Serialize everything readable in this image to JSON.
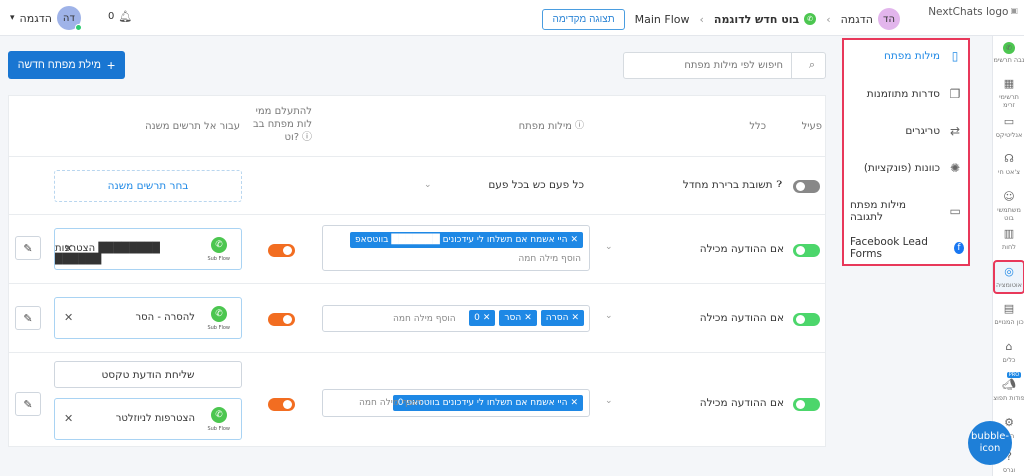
{
  "topbar": {
    "logo_alt": "NextChats logo",
    "workspace_avatar": "הד",
    "workspace_name": "הדגמה",
    "bot_name": "בוט חדש לדוגמה",
    "flow_name": "Main Flow",
    "preview_label": "תצוגה מקדימה",
    "notif_count": "0",
    "user_avatar": "דה",
    "user_name": "הדגמה"
  },
  "rail": {
    "items": [
      {
        "label": "נבה תרשימ",
        "icon": "whatsapp-icon"
      },
      {
        "label": "תרשימי זרימ",
        "icon": "grid-icon"
      },
      {
        "label": "אנליטיקס",
        "icon": "chart-icon"
      },
      {
        "label": "צ'אט חי",
        "icon": "headset-icon"
      },
      {
        "label": "משתמשי בוט",
        "icon": "user-icon"
      },
      {
        "label": "לחות",
        "icon": "book-icon"
      },
      {
        "label": "אוטומציה",
        "icon": "robot-icon"
      },
      {
        "label": "כון המנויים",
        "icon": "calendar-icon"
      },
      {
        "label": "כלים",
        "icon": "store-icon"
      },
      {
        "label": "פודות תפוצ",
        "icon": "megaphone-icon",
        "badge": "PRO"
      },
      {
        "label": "הגד",
        "icon": "gear-icon"
      },
      {
        "label": "וגרס",
        "icon": "help-icon"
      }
    ]
  },
  "submenu": {
    "items": [
      {
        "label": "מילות מפתח",
        "icon": "document-icon",
        "active": true
      },
      {
        "label": "סדרות מתוזמנות",
        "icon": "sequence-icon"
      },
      {
        "label": "טריגרים",
        "icon": "repeat-icon"
      },
      {
        "label": "כוונות (פונקציות)",
        "icon": "openai-icon"
      },
      {
        "label": "מילות מפתח לתגובה",
        "icon": "comment-icon"
      },
      {
        "label": "Facebook Lead Forms",
        "icon": "facebook-icon"
      }
    ]
  },
  "toolbar": {
    "new_keyword": "מילת מפתח חדשה",
    "search_placeholder": "חיפוש לפי מילות מפתח"
  },
  "table": {
    "headers": {
      "active": "פעיל",
      "rule": "כלל",
      "keywords": "מילות מפתח",
      "ignore_line1": "להתעלם ממי",
      "ignore_line2": "לות מפתח בב",
      "ignore_line3": "וט?",
      "go_to": "עבור אל תרשים משנה"
    },
    "default_row": {
      "rule": "תשובת ברירת מחדל",
      "frequency": "כל פעם כש בכל פעם",
      "choose_subflow": "בחר תרשים משנה"
    },
    "rows": [
      {
        "rule": "אם ההודעה מכילה",
        "chips": [
          "היי אשמח אם תשלחו לי עידכונים ███████ בווטסאפ"
        ],
        "add_placeholder": "הוסף מילה חמה",
        "subflow": "הצטרפות ████████ ██████",
        "subflow_tag": "Sub Flow"
      },
      {
        "rule": "אם ההודעה מכילה",
        "chips": [
          "0",
          "הסר",
          "הסרה"
        ],
        "add_placeholder": "הוסף מילה חמה",
        "subflow": "להסרה - הסר",
        "subflow_tag": "Sub Flow"
      },
      {
        "rule": "אם ההודעה מכילה",
        "chips": [
          "היי אשמח אם תשלחו לי עידכונים בווטסאפ 0"
        ],
        "add_placeholder": "הוסף מילה חמה",
        "action": "שליחת הודעת טקסט",
        "subflow": "הצטרפות לניוזלטר",
        "subflow_tag": "Sub Flow"
      }
    ]
  },
  "bubble": "bubble-icon",
  "colors": {
    "primary": "#1976d2",
    "highlight": "#e8385a",
    "toggle_on": "#4cd66b",
    "toggle_orange": "#f26d21"
  }
}
